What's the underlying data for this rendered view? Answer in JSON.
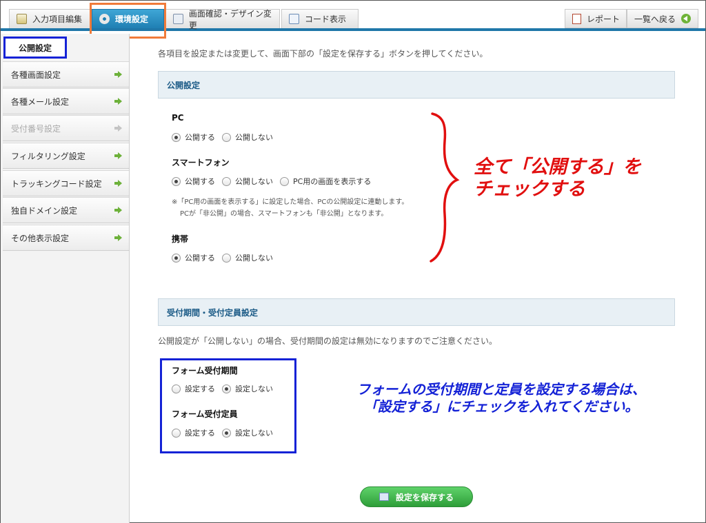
{
  "tabs": [
    {
      "label": "入力項目編集",
      "icon": "edit-icon"
    },
    {
      "label": "環境設定",
      "icon": "gear-icon"
    },
    {
      "label": "画面確認・デザイン変更",
      "icon": "screen-icon"
    },
    {
      "label": "コード表示",
      "icon": "code-icon"
    }
  ],
  "header_right": {
    "report_label": "レポート",
    "back_label": "一覧へ戻る"
  },
  "sidebar": {
    "heading": "公開設定",
    "items": [
      {
        "label": "各種画面設定",
        "enabled": true
      },
      {
        "label": "各種メール設定",
        "enabled": true
      },
      {
        "label": "受付番号設定",
        "enabled": false
      },
      {
        "label": "フィルタリング設定",
        "enabled": true
      },
      {
        "label": "トラッキングコード設定",
        "enabled": true
      },
      {
        "label": "独自ドメイン設定",
        "enabled": true
      },
      {
        "label": "その他表示設定",
        "enabled": true
      }
    ]
  },
  "main": {
    "intro": "各項目を設定または変更して、画面下部の「設定を保存する」ボタンを押してください。",
    "publish_section": {
      "title": "公開設定",
      "pc": {
        "label": "PC",
        "options": [
          "公開する",
          "公開しない"
        ],
        "selected": 0
      },
      "smartphone": {
        "label": "スマートフォン",
        "options": [
          "公開する",
          "公開しない",
          "PC用の画面を表示する"
        ],
        "selected": 0
      },
      "note_line1": "※「PC用の画面を表示する」に設定した場合、PCの公開設定に連動します。",
      "note_line2": "PCが「非公開」の場合、スマートフォンも「非公開」となります。",
      "mobile": {
        "label": "携帯",
        "options": [
          "公開する",
          "公開しない"
        ],
        "selected": 0
      }
    },
    "period_section": {
      "title": "受付期間・受付定員設定",
      "note": "公開設定が「公開しない」の場合、受付期間の設定は無効になりますのでご注意ください。",
      "period": {
        "label": "フォーム受付期間",
        "options": [
          "設定する",
          "設定しない"
        ],
        "selected": 1
      },
      "capacity": {
        "label": "フォーム受付定員",
        "options": [
          "設定する",
          "設定しない"
        ],
        "selected": 1
      }
    },
    "annotation_red_line1": "全て「公開する」を",
    "annotation_red_line2": "チェックする",
    "annotation_blue_line1": "フォームの受付期間と定員を設定する場合は、",
    "annotation_blue_line2": "「設定する」にチェックを入れてください。",
    "save_label": "設定を保存する"
  },
  "colors": {
    "accent": "#1f77a9",
    "highlight_orange": "#f07b3a",
    "highlight_blue": "#1422d6",
    "annotation_red": "#e10f0f",
    "save_green": "#3bb346"
  }
}
